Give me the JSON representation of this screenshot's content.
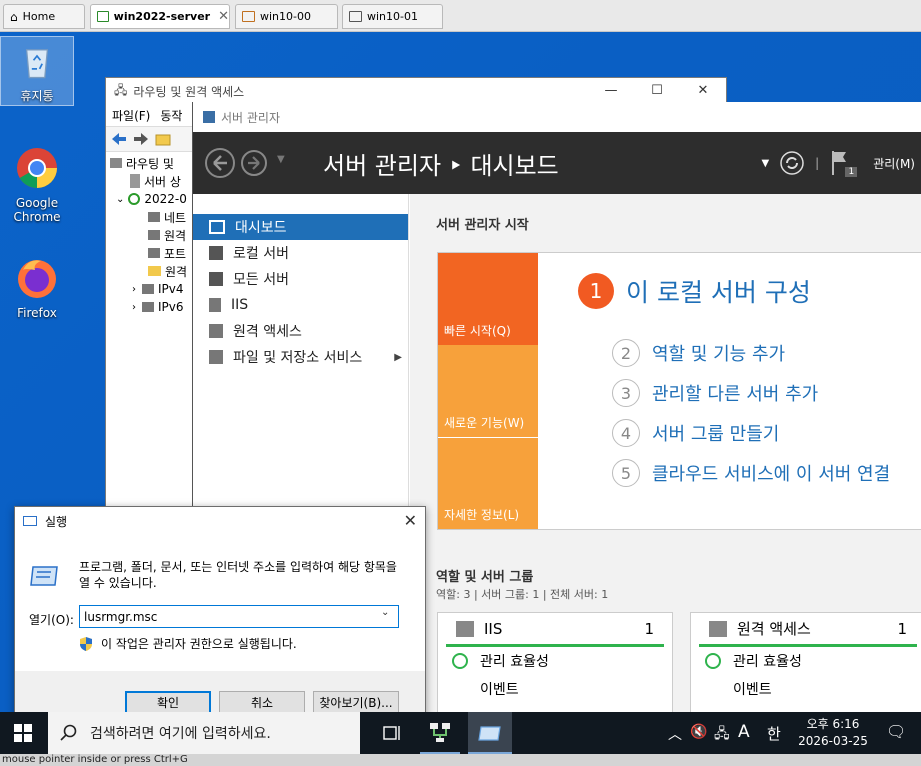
{
  "vm_tabs": [
    {
      "label": "Home"
    },
    {
      "label": "win2022-server"
    },
    {
      "label": "win10-00"
    },
    {
      "label": "win10-01"
    }
  ],
  "desktop": {
    "icons": [
      {
        "label": "휴지통"
      },
      {
        "label": "Google Chrome"
      },
      {
        "label": "Firefox"
      }
    ]
  },
  "rras_window": {
    "title": "라우팅 및 원격 액세스",
    "menu": [
      "파일(F)",
      "동작"
    ],
    "tree": [
      "라우팅 및",
      "서버 상",
      "2022-0",
      "네트",
      "원격",
      "포트",
      "원격",
      "IPv4",
      "IPv6"
    ]
  },
  "server_manager": {
    "window_title": "서버 관리자",
    "header_title": "서버 관리자 ‣ 대시보드",
    "manage_label": "관리(M)",
    "flag_count": "1",
    "nav": [
      {
        "label": "대시보드"
      },
      {
        "label": "로컬 서버"
      },
      {
        "label": "모든 서버"
      },
      {
        "label": "IIS"
      },
      {
        "label": "원격 액세스"
      },
      {
        "label": "파일 및 저장소 서비스"
      }
    ],
    "welcome_header": "서버 관리자 시작",
    "tiles": [
      {
        "label": "빠른 시작(Q)"
      },
      {
        "label": "새로운 기능(W)"
      },
      {
        "label": "자세한 정보(L)"
      }
    ],
    "steps": [
      {
        "num": "1",
        "label": "이 로컬 서버 구성"
      },
      {
        "num": "2",
        "label": "역할 및 기능 추가"
      },
      {
        "num": "3",
        "label": "관리할 다른 서버 추가"
      },
      {
        "num": "4",
        "label": "서버 그룹 만들기"
      },
      {
        "num": "5",
        "label": "클라우드 서비스에 이 서버 연결"
      }
    ],
    "roles_header": "역할 및 서버 그룹",
    "roles_sub": "역할: 3   |   서버 그룹: 1   |   전체 서버: 1",
    "role_cards": [
      {
        "name": "IIS",
        "count": "1",
        "rows": [
          "관리 효율성",
          "이벤트"
        ]
      },
      {
        "name": "원격 액세스",
        "count": "1",
        "rows": [
          "관리 효율성",
          "이벤트"
        ]
      }
    ]
  },
  "run_dialog": {
    "title": "실행",
    "description": "프로그램, 폴더, 문서, 또는 인터넷 주소를 입력하여 해당 항목을 열 수 있습니다.",
    "open_label": "열기(O):",
    "input_value": "lusrmgr.msc",
    "admin_note": "이 작업은 관리자 권한으로 실행됩니다.",
    "buttons": {
      "ok": "확인",
      "cancel": "취소",
      "browse": "찾아보기(B)..."
    }
  },
  "taskbar": {
    "search_placeholder": "검색하려면 여기에 입력하세요.",
    "ime": "A",
    "ime2": "한",
    "time": "오후 6:16",
    "date": "2026-03-25"
  },
  "status_bar": "mouse pointer inside or press Ctrl+G"
}
